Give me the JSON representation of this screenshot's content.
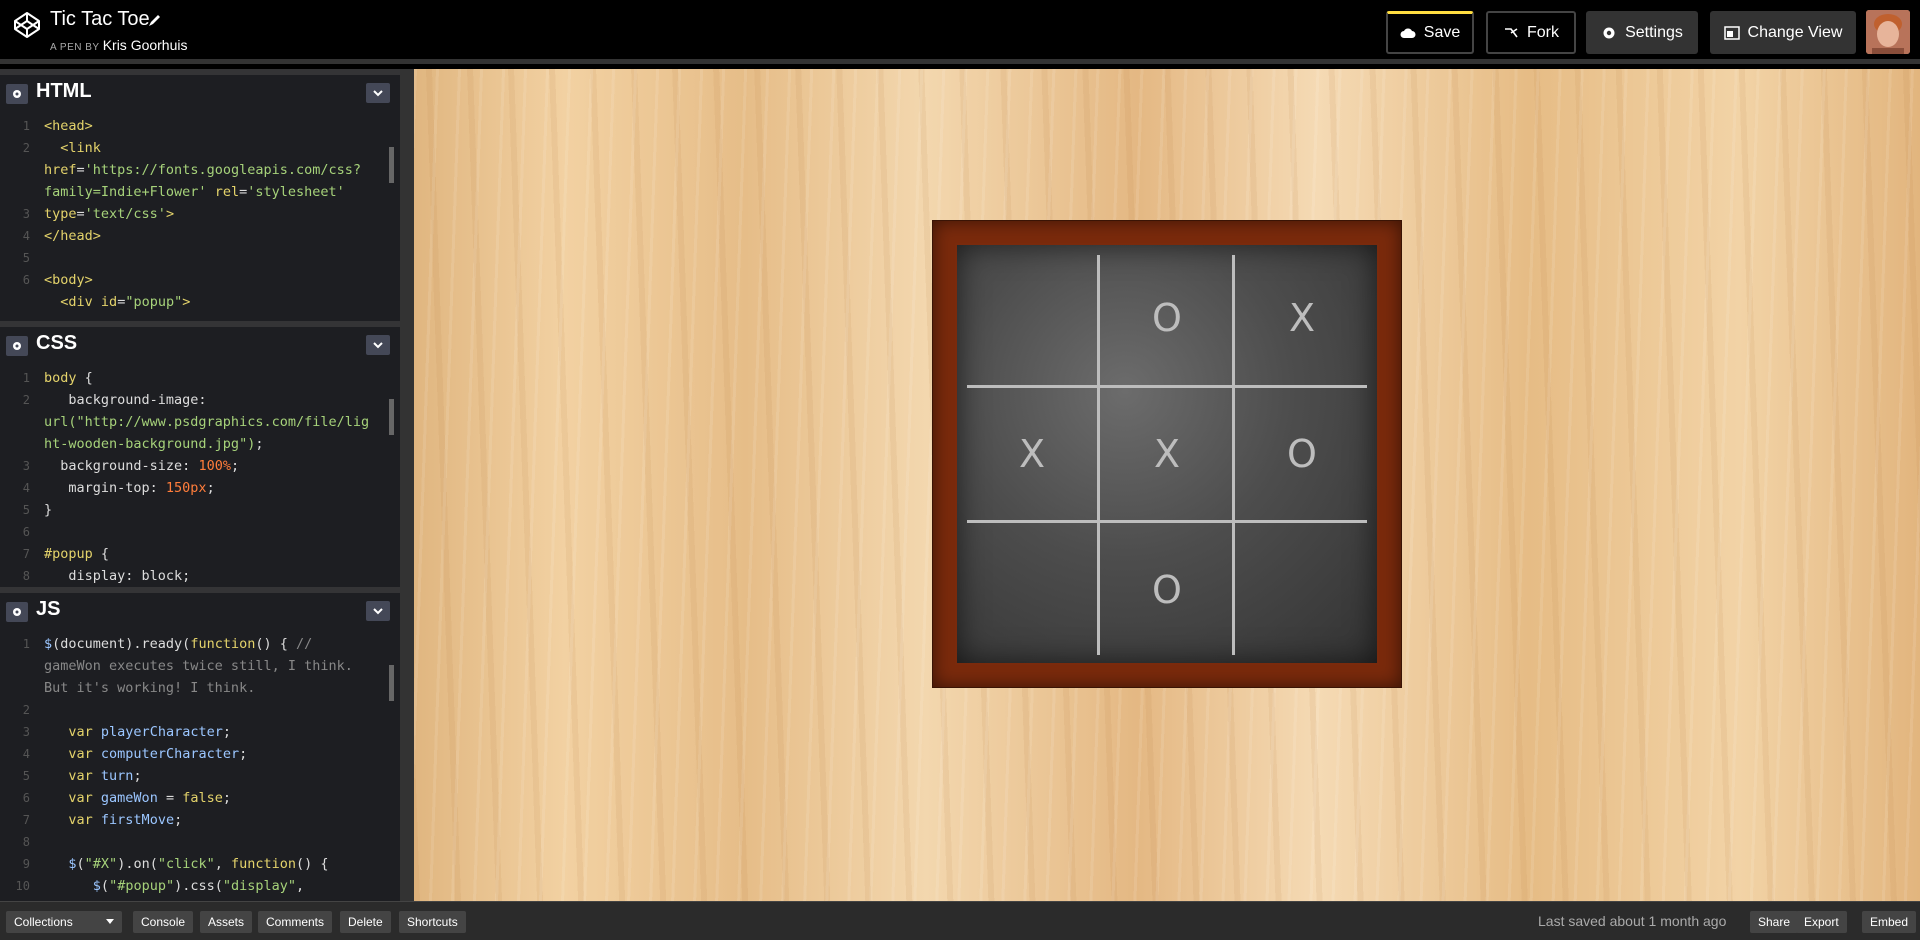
{
  "header": {
    "title": "Tic Tac Toe",
    "pen_by_prefix": "A PEN BY",
    "author": "Kris Goorhuis",
    "buttons": {
      "save": "Save",
      "fork": "Fork",
      "settings": "Settings",
      "change_view": "Change View"
    }
  },
  "editors": {
    "html": {
      "name": "HTML",
      "line_numbers": [
        "1",
        "2",
        "",
        "",
        "3",
        "4",
        "5",
        "6"
      ]
    },
    "css": {
      "name": "CSS",
      "line_numbers": [
        "1",
        "2",
        "",
        "",
        "3",
        "4",
        "5",
        "6",
        "7",
        "8"
      ]
    },
    "js": {
      "name": "JS",
      "line_numbers": [
        "1",
        "",
        "",
        "2",
        "3",
        "4",
        "5",
        "6",
        "7",
        "8",
        "9",
        "10"
      ]
    }
  },
  "board": {
    "cells": [
      "",
      "O",
      "X",
      "X",
      "X",
      "O",
      "",
      "O",
      ""
    ]
  },
  "footer": {
    "collections": "Collections",
    "console": "Console",
    "assets": "Assets",
    "comments": "Comments",
    "delete": "Delete",
    "shortcuts": "Shortcuts",
    "last_saved": "Last saved about 1 month ago",
    "share": "Share",
    "export": "Export",
    "embed": "Embed"
  },
  "colors": {
    "save_accent": "#ffdd40",
    "frame": "#7a2a0c",
    "chalkboard": "#4d4d4d"
  }
}
